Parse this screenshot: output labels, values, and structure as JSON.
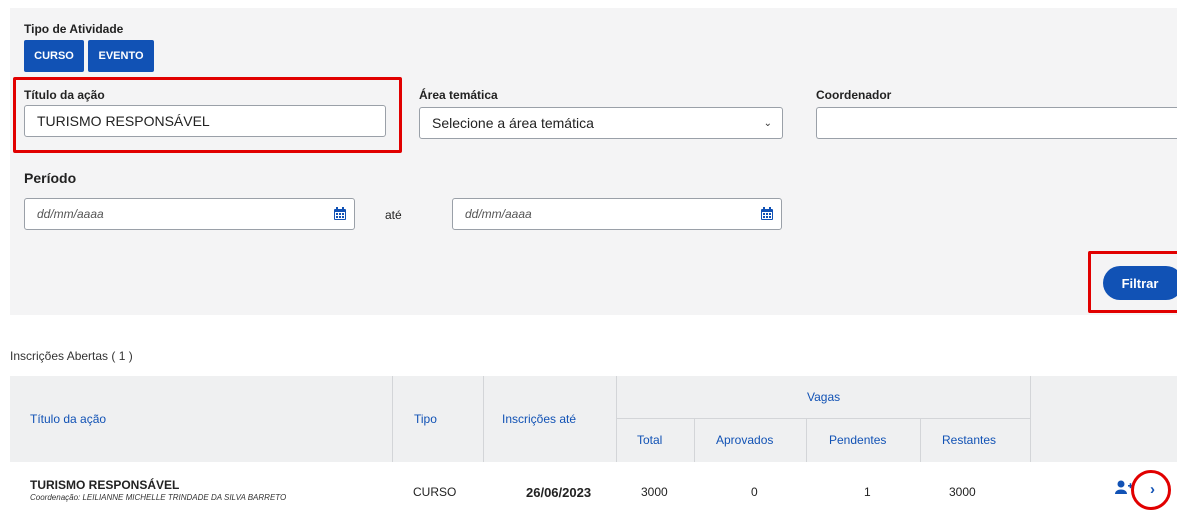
{
  "filters": {
    "tipo_label": "Tipo de Atividade",
    "tipo_buttons": [
      "CURSO",
      "EVENTO"
    ],
    "titulo_label": "Título da ação",
    "titulo_value": "TURISMO RESPONSÁVEL",
    "area_label": "Área temática",
    "area_value": "Selecione a área temática",
    "coordenador_label": "Coordenador",
    "coordenador_value": "",
    "periodo_label": "Período",
    "date_start_placeholder": "dd/mm/aaaa",
    "ate": "até",
    "date_end_placeholder": "dd/mm/aaaa",
    "filtrar_label": "Filtrar"
  },
  "results": {
    "title": "Inscrições Abertas ( 1 )",
    "headers": {
      "titulo": "Título da ação",
      "tipo": "Tipo",
      "inscricoes": "Inscrições até",
      "vagas": "Vagas",
      "total": "Total",
      "aprovados": "Aprovados",
      "pendentes": "Pendentes",
      "restantes": "Restantes"
    },
    "rows": [
      {
        "titulo": "TURISMO RESPONSÁVEL",
        "coordenacao": "Coordenação: LEILIANNE MICHELLE TRINDADE DA SILVA BARRETO",
        "tipo": "CURSO",
        "inscricoes_ate": "26/06/2023",
        "total": "3000",
        "aprovados": "0",
        "pendentes": "1",
        "restantes": "3000"
      }
    ]
  },
  "icons": {
    "calendar": "calendar-icon",
    "add_user": "add-user-icon",
    "chevron": "chevron-right-icon"
  },
  "colors": {
    "primary": "#1152b5",
    "highlight": "#e10000",
    "panel": "#f4f4f5"
  }
}
